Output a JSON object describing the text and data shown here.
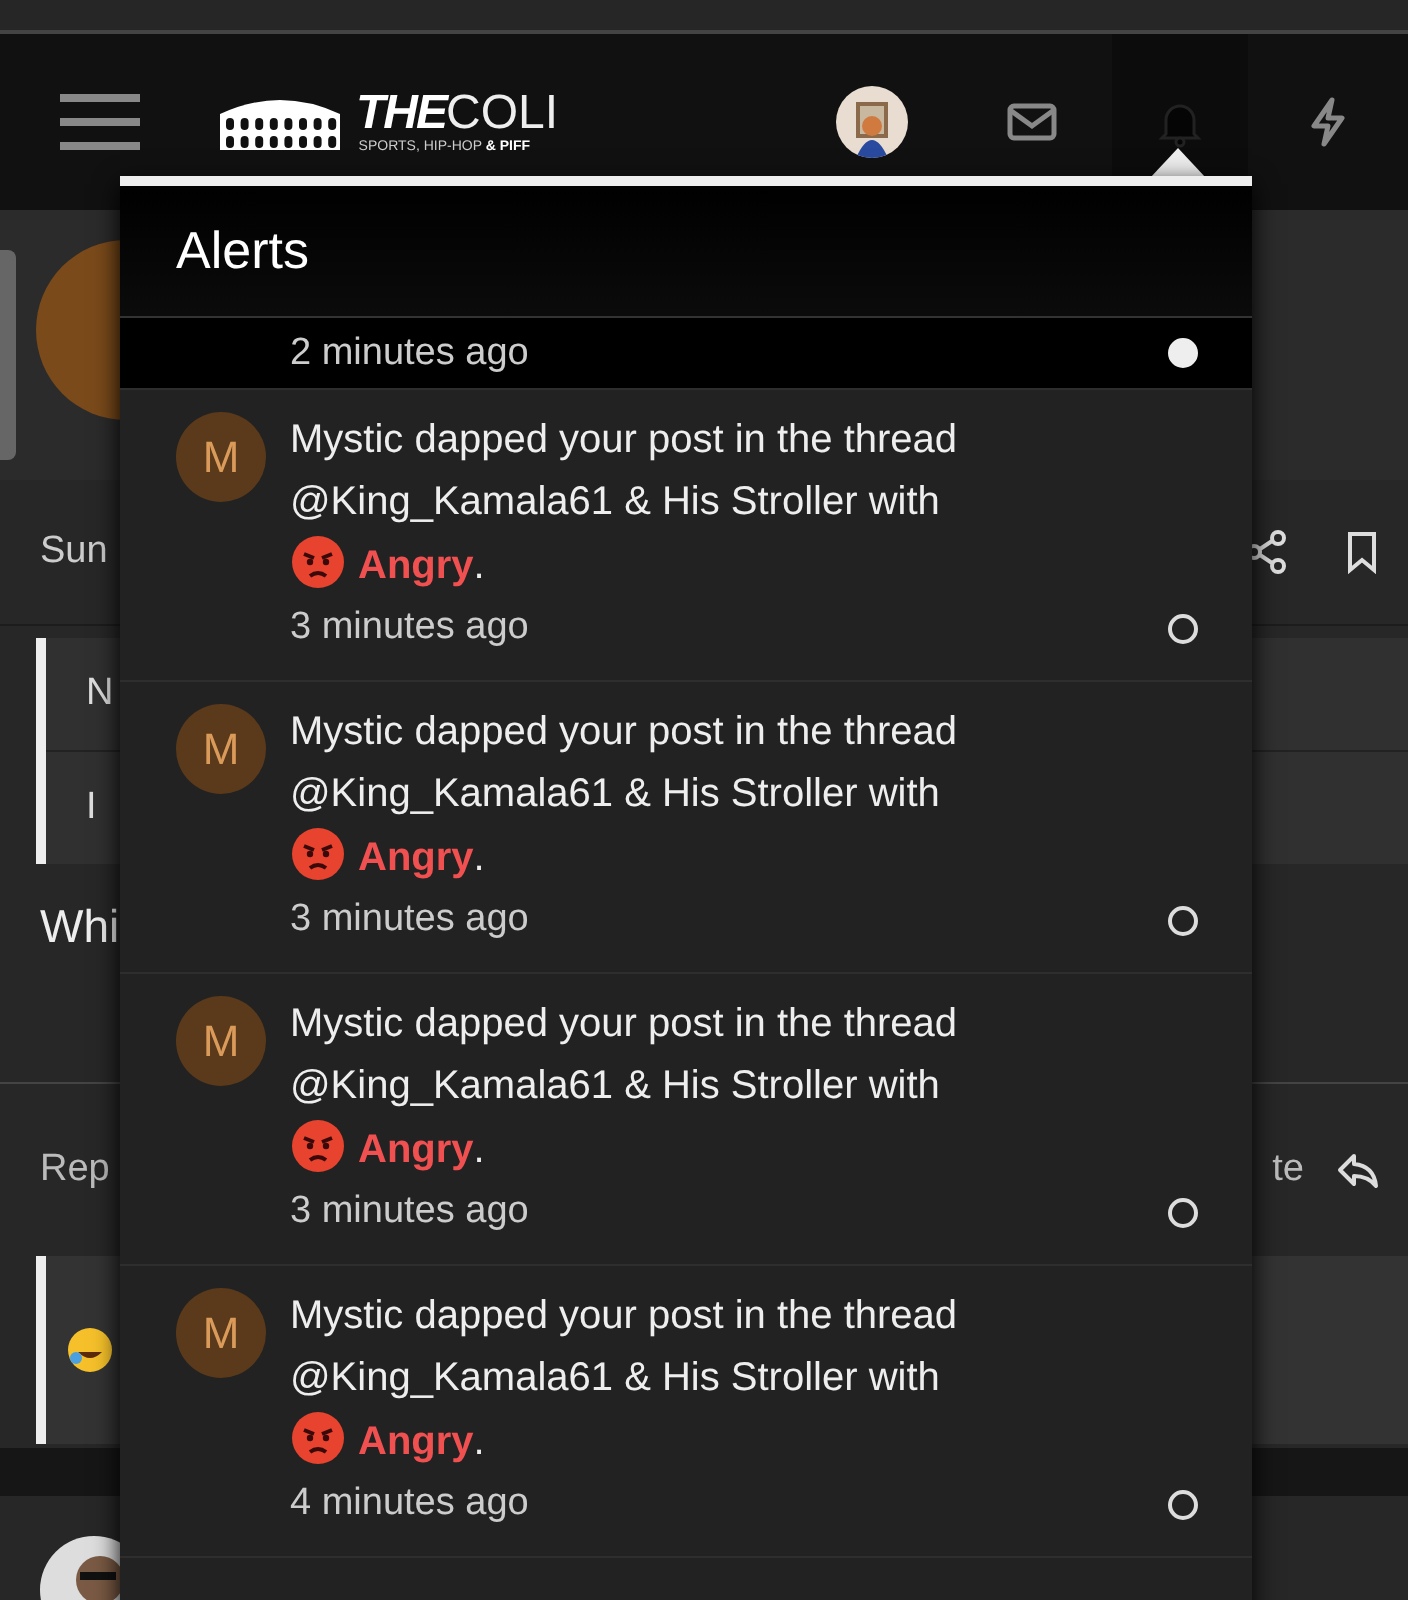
{
  "header": {
    "logo": {
      "word_1": "THE",
      "word_2": "COLI",
      "tagline": "SPORTS, HIP-HOP **& PIFF**"
    },
    "icons": [
      {
        "kind": "avatar",
        "selected": false
      },
      {
        "kind": "mail",
        "selected": false
      },
      {
        "kind": "bell",
        "selected": true
      },
      {
        "kind": "bolt",
        "selected": false
      }
    ]
  },
  "page": {
    "meta": "Sun",
    "quote_lines": [
      "N",
      "I"
    ],
    "body": "Whi",
    "reply": "Rep",
    "action": "te"
  },
  "alerts": {
    "title": "Alerts",
    "items": [
      {
        "kind": "partial",
        "time": "2 minutes ago",
        "read": false
      },
      {
        "kind": "dap",
        "initial": "M",
        "text": "Mystic dapped your post in the thread @King_Kamala61 & His Stroller with",
        "reaction": "Angry",
        "suffix": ".",
        "time": "3 minutes ago",
        "read": true
      },
      {
        "kind": "dap",
        "initial": "M",
        "text": "Mystic dapped your post in the thread @King_Kamala61 & His Stroller with",
        "reaction": "Angry",
        "suffix": ".",
        "time": "3 minutes ago",
        "read": true
      },
      {
        "kind": "dap",
        "initial": "M",
        "text": "Mystic dapped your post in the thread @King_Kamala61 & His Stroller with",
        "reaction": "Angry",
        "suffix": ".",
        "time": "3 minutes ago",
        "read": true
      },
      {
        "kind": "dap",
        "initial": "M",
        "text": "Mystic dapped your post in the thread @King_Kamala61 & His Stroller with",
        "reaction": "Angry",
        "suffix": ".",
        "time": "4 minutes ago",
        "read": true
      }
    ]
  }
}
